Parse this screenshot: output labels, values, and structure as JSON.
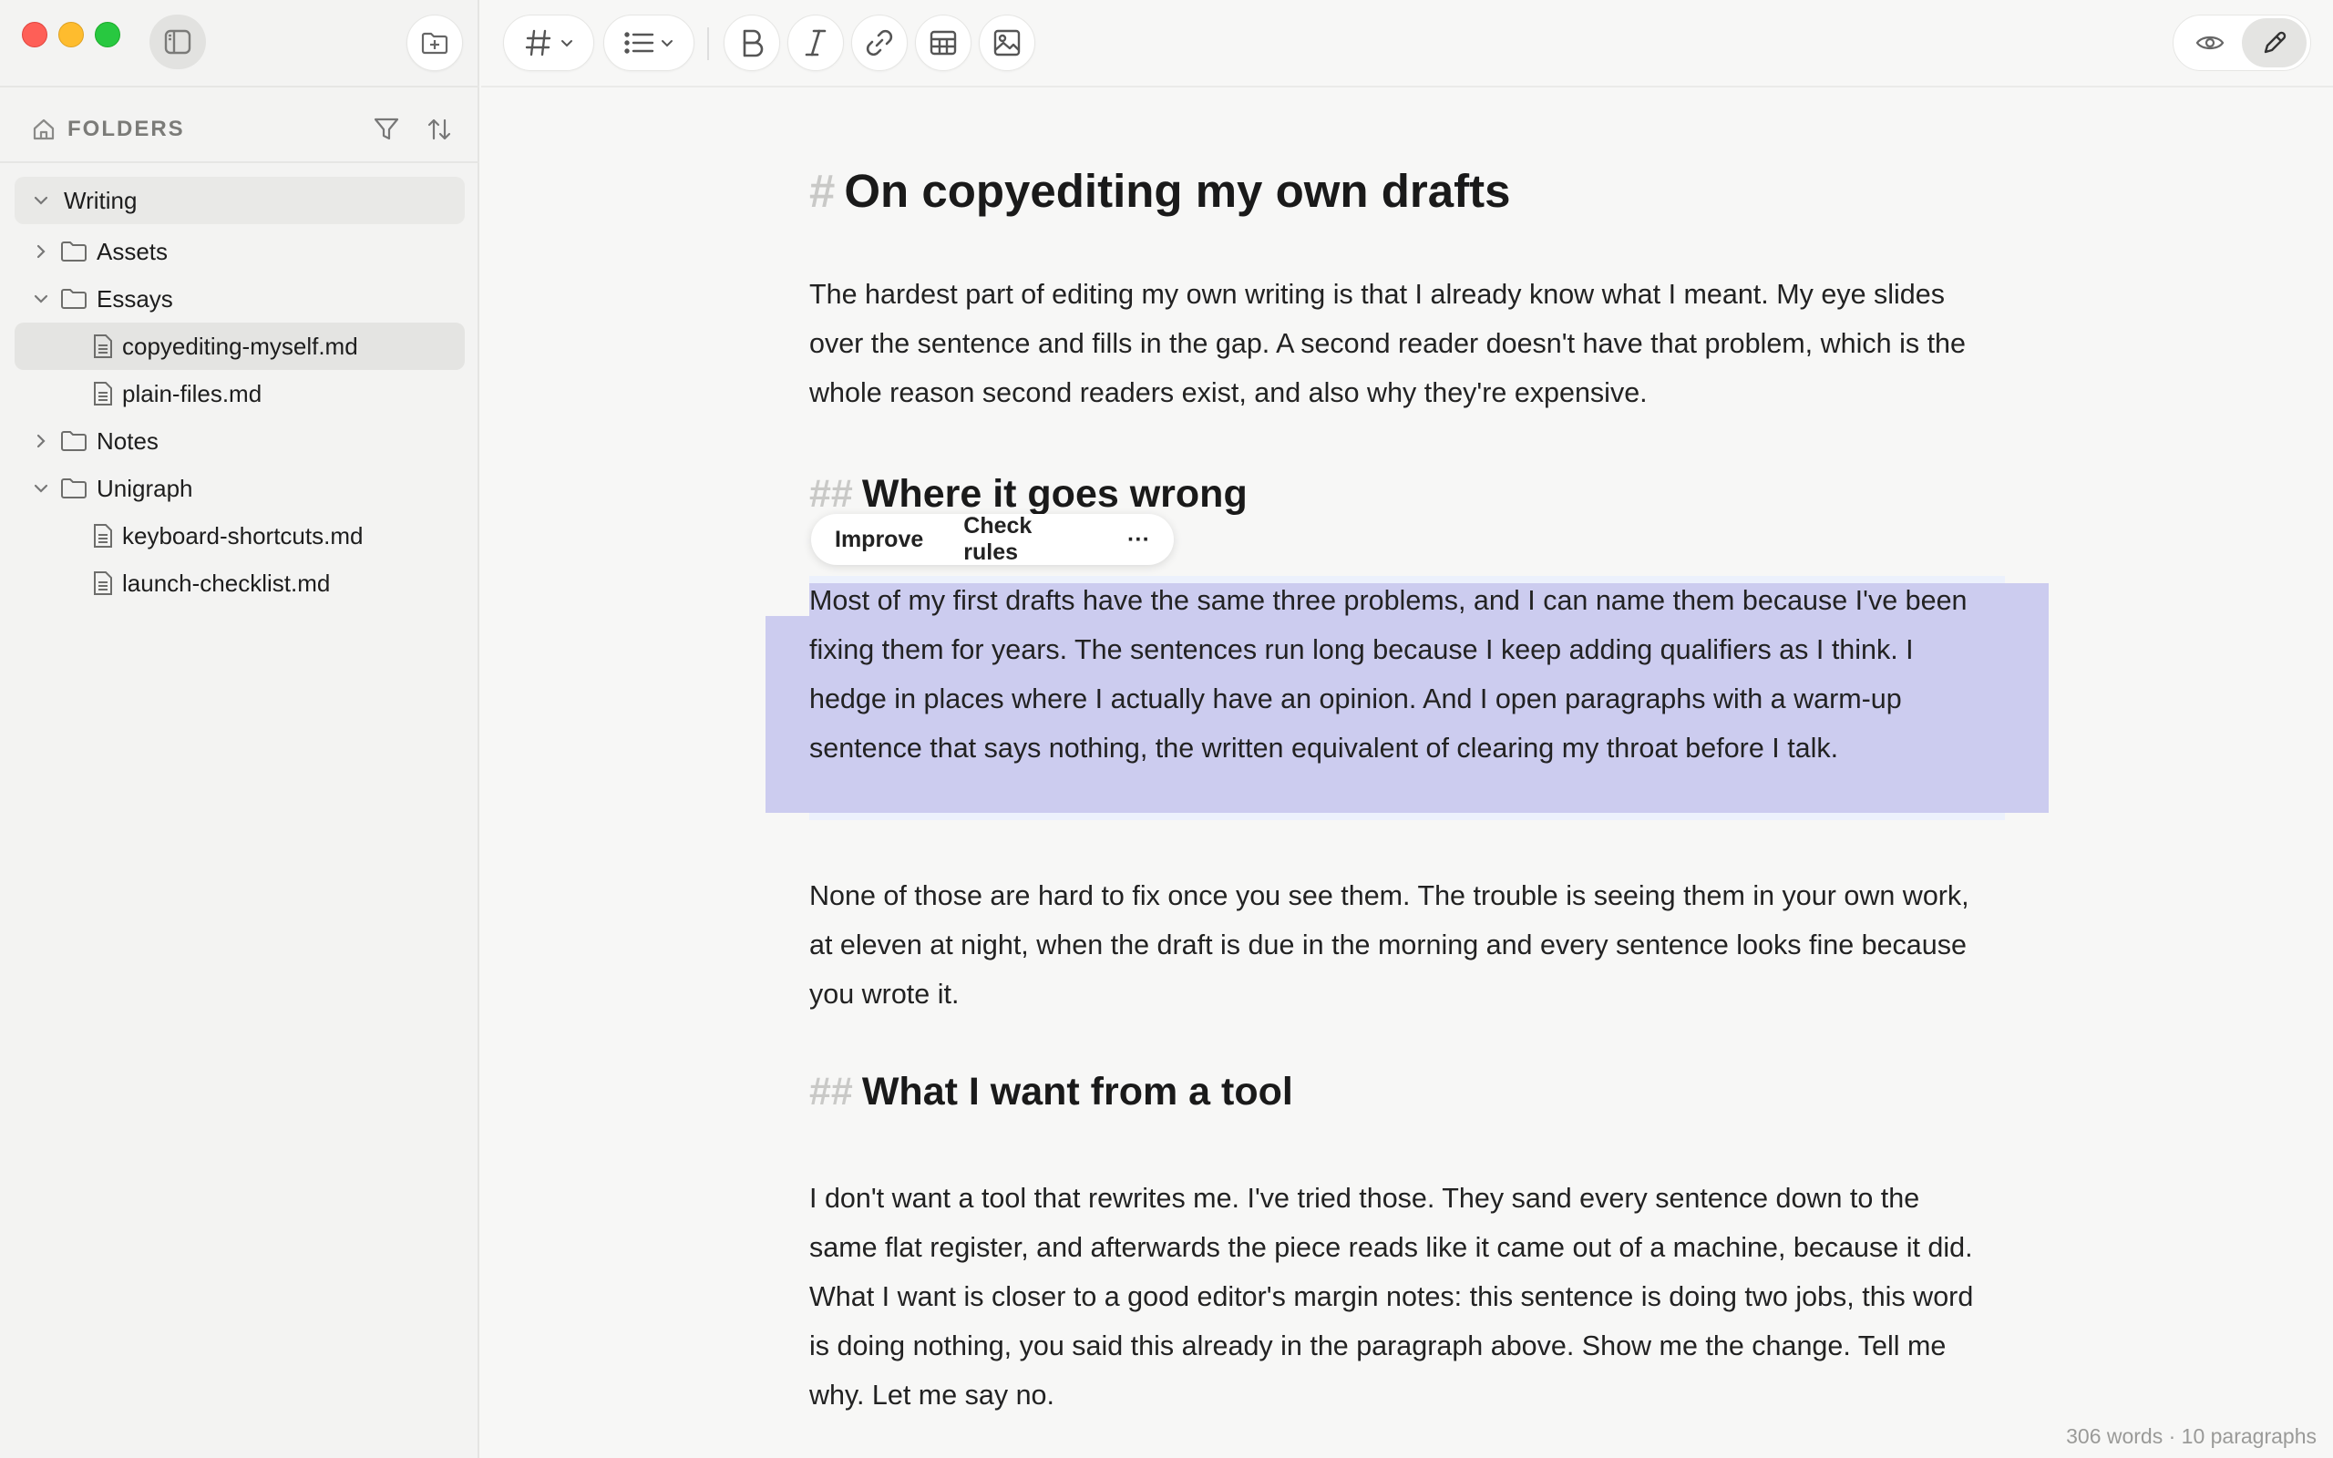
{
  "sidebar": {
    "header_label": "FOLDERS",
    "tree": [
      {
        "label": "Writing",
        "kind": "root",
        "expanded": true
      },
      {
        "label": "Assets",
        "kind": "folder",
        "expanded": false
      },
      {
        "label": "Essays",
        "kind": "folder",
        "expanded": true
      },
      {
        "label": "copyediting-myself.md",
        "kind": "file",
        "selected": true
      },
      {
        "label": "plain-files.md",
        "kind": "file"
      },
      {
        "label": "Notes",
        "kind": "folder",
        "expanded": false
      },
      {
        "label": "Unigraph",
        "kind": "folder",
        "expanded": true
      },
      {
        "label": "keyboard-shortcuts.md",
        "kind": "file"
      },
      {
        "label": "launch-checklist.md",
        "kind": "file"
      }
    ]
  },
  "toolbar": {
    "icons": [
      "heading-icon",
      "list-icon",
      "bold-icon",
      "italic-icon",
      "link-icon",
      "table-icon",
      "image-icon",
      "preview-icon",
      "edit-icon"
    ]
  },
  "document": {
    "h1_mark": "#",
    "h1": "On copyediting my own drafts",
    "p1": "The hardest part of editing my own writing is that I already know what I meant. My eye slides over the sentence and fills in the gap. A second reader doesn't have that problem, which is the whole reason second readers exist, and also why they're expensive.",
    "h2_mark": "##",
    "h2a": "Where it goes wrong",
    "p2": "Most of my first drafts have the same three problems, and I can name them because I've been fixing them for years. The sentences run long because I keep adding qualifiers as I think. I hedge in places where I actually have an opinion. And I open paragraphs with a warm-up sentence that says nothing, the written equivalent of clearing my throat before I talk.",
    "p3": "None of those are hard to fix once you see them. The trouble is seeing them in your own work, at eleven at night, when the draft is due in the morning and every sentence looks fine because you wrote it.",
    "h2b": "What I want from a tool",
    "p4": "I don't want a tool that rewrites me. I've tried those. They sand every sentence down to the same flat register, and afterwards the piece reads like it came out of a machine, because it did. What I want is closer to a good editor's margin notes: this sentence is doing two jobs, this word is doing nothing, you said this already in the paragraph above. Show me the change. Tell me why. Let me say no."
  },
  "popup": {
    "improve": "Improve",
    "check_rules": "Check rules",
    "more": "···"
  },
  "status": "306 words · 10 paragraphs",
  "colors": {
    "selection": "#ccccef",
    "selection_light": "#ecf1fc",
    "close": "#fe5f57",
    "minimize": "#febc2e",
    "zoom": "#28c840"
  }
}
